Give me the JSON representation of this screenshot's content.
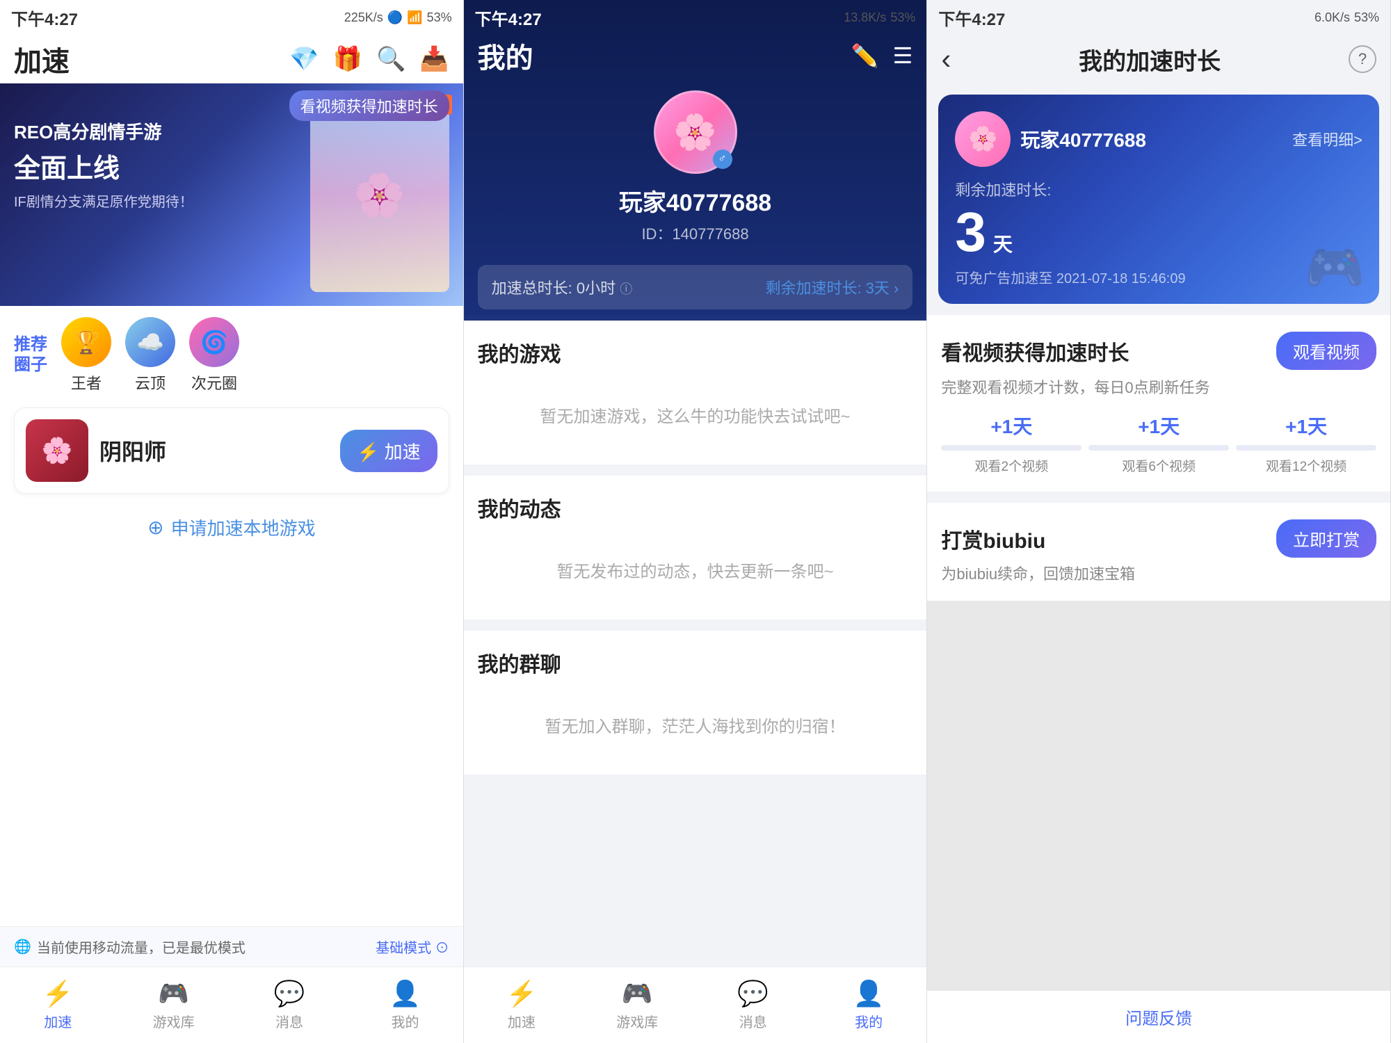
{
  "panel1": {
    "status": {
      "time": "下午4:27",
      "speed": "225K/s",
      "battery": "53%"
    },
    "title": "加速",
    "watchVideoTip": "看视频获得加速时长",
    "banner": {
      "brand": "REO",
      "line1": "REO高分剧情手游",
      "line2": "全面上线",
      "line3": "IF剧情分支满足原作党期待！"
    },
    "recommend": {
      "label": "推荐\n圈子",
      "items": [
        {
          "name": "王者",
          "icon": "🏆"
        },
        {
          "name": "云顶",
          "icon": "☁️"
        },
        {
          "name": "次元圈",
          "icon": "🌀"
        }
      ]
    },
    "game": {
      "name": "阴阳师",
      "icon": "🌸",
      "btnLabel": "⚡ 加速"
    },
    "applyLabel": "申请加速本地游戏",
    "footer": {
      "tip": "当前使用移动流量，已是最优模式",
      "modeLabel": "基础模式 ⊙"
    },
    "nav": [
      {
        "icon": "⚡",
        "label": "加速",
        "active": true
      },
      {
        "icon": "🎮",
        "label": "游戏库",
        "active": false
      },
      {
        "icon": "💬",
        "label": "消息",
        "active": false
      },
      {
        "icon": "👤",
        "label": "我的",
        "active": false
      }
    ]
  },
  "panel2": {
    "status": {
      "time": "下午4:27",
      "speed": "13.8K/s",
      "battery": "53%"
    },
    "title": "我的",
    "profile": {
      "avatar": "🌸",
      "name": "玩家40777688",
      "id": "ID：140777688",
      "gender": "♂"
    },
    "accelTime": {
      "totalLabel": "加速总时长: 0小时",
      "remainLabel": "剩余加速时长: 3天",
      "arrow": ">"
    },
    "sections": [
      {
        "title": "我的游戏",
        "emptyText": "暂无加速游戏，这么牛的功能快去试试吧~"
      },
      {
        "title": "我的动态",
        "emptyText": "暂无发布过的动态，快去更新一条吧~"
      },
      {
        "title": "我的群聊",
        "emptyText": "暂无加入群聊，茫茫人海找到你的归宿！"
      }
    ],
    "nav": [
      {
        "icon": "⚡",
        "label": "加速",
        "active": false
      },
      {
        "icon": "🎮",
        "label": "游戏库",
        "active": false
      },
      {
        "icon": "💬",
        "label": "消息",
        "active": false
      },
      {
        "icon": "👤",
        "label": "我的",
        "active": true
      }
    ]
  },
  "panel3": {
    "status": {
      "time": "下午4:27",
      "speed": "6.0K/s",
      "battery": "53%"
    },
    "title": "我的加速时长",
    "backLabel": "‹",
    "helpLabel": "?",
    "card": {
      "userName": "玩家40777688",
      "viewDetail": "查看明细>",
      "remainLabel": "剩余加速时长:",
      "days": "3",
      "daysUnit": "天",
      "expireText": "可免广告加速至 2021-07-18 15:46:09"
    },
    "watchVideo": {
      "sectionTitle": "看视频获得加速时长",
      "btnLabel": "观看视频",
      "desc": "完整观看视频才计数，每日0点刷新任务",
      "rewards": [
        {
          "plus": "+1天",
          "label": "观看2个视频",
          "fill": 0
        },
        {
          "plus": "+1天",
          "label": "观看6个视频",
          "fill": 0
        },
        {
          "plus": "+1天",
          "label": "观看12个视频",
          "fill": 0
        }
      ]
    },
    "reward": {
      "sectionTitle": "打赏biubiu",
      "btnLabel": "立即打赏",
      "desc": "为biubiu续命，回馈加速宝箱"
    },
    "feedbackLabel": "问题反馈"
  }
}
